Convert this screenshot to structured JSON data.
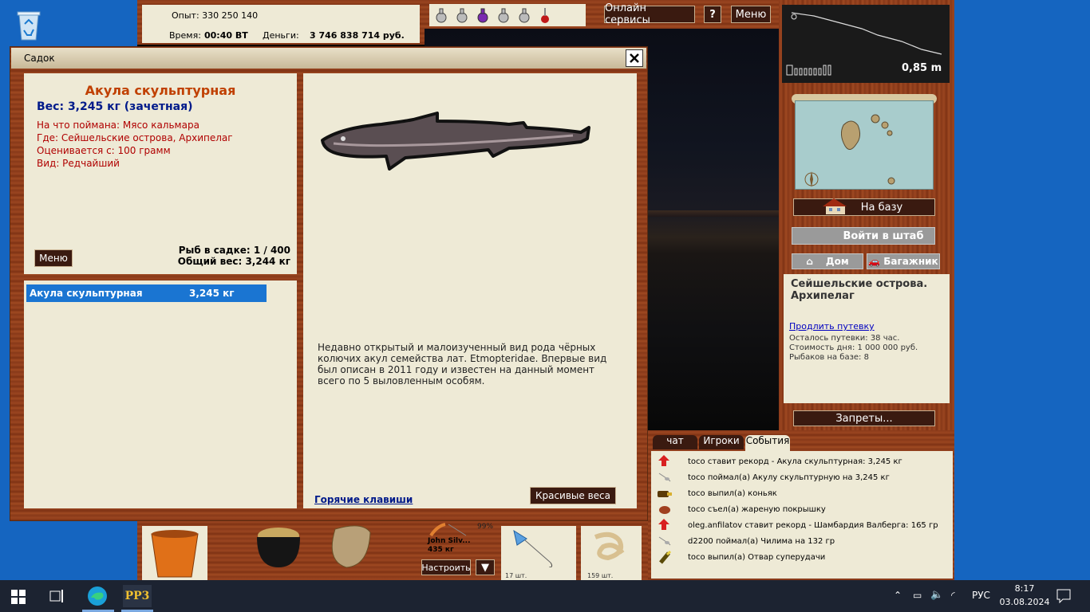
{
  "desktop": {
    "recycle_bin": "Корзина"
  },
  "top_info": {
    "exp_label": "Опыт:",
    "exp_value": "330 250 140",
    "time_label": "Время:",
    "time_value": "00:40 ВТ",
    "money_label": "Деньги:",
    "money_value": "3 746 838 714 руб."
  },
  "top_buttons": {
    "online": "Онлайн сервисы",
    "help": "?",
    "menu": "Меню"
  },
  "depth": {
    "value": "0,85 m"
  },
  "right_panel": {
    "to_base": "На базу",
    "hq": "Войти в штаб",
    "home": "Дом",
    "trunk": "Багажник",
    "location_title": "Сейшельские острова. Архипелаг",
    "extend_link": "Продлить путевку",
    "remaining": "Осталось путевки: 38 час.",
    "cost": "Стоимость дня: 1 000 000 руб.",
    "fishers": "Рыбаков на базе: 8",
    "bans": "Запреты..."
  },
  "events": {
    "tabs": [
      "чат",
      "Игроки",
      "События"
    ],
    "items": [
      {
        "icon": "record-arrow-icon",
        "text": "toco ставит рекорд - Акула скульптурная: 3,245 кг"
      },
      {
        "icon": "fish-catch-icon",
        "text": "toco поймал(а) Акулу скульптурную на 3,245 кг"
      },
      {
        "icon": "bottle-icon",
        "text": "toco выпил(а) коньяк"
      },
      {
        "icon": "food-icon",
        "text": "toco съел(а) жареную покрышку"
      },
      {
        "icon": "record-arrow-icon",
        "text": "oleg.anfilatov ставит рекорд - Шамбардия Валберга: 165 гр"
      },
      {
        "icon": "fish-catch-icon",
        "text": "d2200 поймал(а) Чилима на 132 гр"
      },
      {
        "icon": "bottle-icon",
        "text": "toco выпил(а) Отвар суперудачи"
      }
    ]
  },
  "bottom_bar": {
    "rod_percent": "99%",
    "rod_name": "John Silv...",
    "rod_weight": "435 кг",
    "setup": "Настроить",
    "slot1_count": "17 шт.",
    "slot2_count": "159 шт."
  },
  "dialog": {
    "title": "Садок",
    "fish_name": "Акула скульптурная",
    "weight_line": "Вес: 3,245 кг (зачетная)",
    "caught_on": "На что поймана: Мясо кальмара",
    "where": "Где: Сейшельские острова, Архипелаг",
    "rated_from": "Оценивается с: 100 грамм",
    "kind": "Вид: Редчайший",
    "menu_btn": "Меню",
    "count": "Рыб в садке: 1 / 400",
    "total": "Общий вес: 3,244 кг",
    "list": [
      {
        "name": "Акула скульптурная",
        "weight": "3,245 кг"
      }
    ],
    "description": "Недавно открытый и малоизученный вид рода чёрных колючих акул семейства лат. Etmopteridae. Впервые вид был описан в 2011 году и известен на данный момент всего по 5 выловленным особям.",
    "hotkeys": "Горячие клавиши",
    "nice_weights": "Красивые веса"
  },
  "taskbar": {
    "lang": "РУС",
    "time": "8:17",
    "date": "03.08.2024",
    "app_label": "РР3"
  },
  "colors": {
    "accent_blue": "#1a75d2",
    "fish_title": "#c04000",
    "weight_blue": "#001a8a",
    "info_red": "#b00000"
  }
}
